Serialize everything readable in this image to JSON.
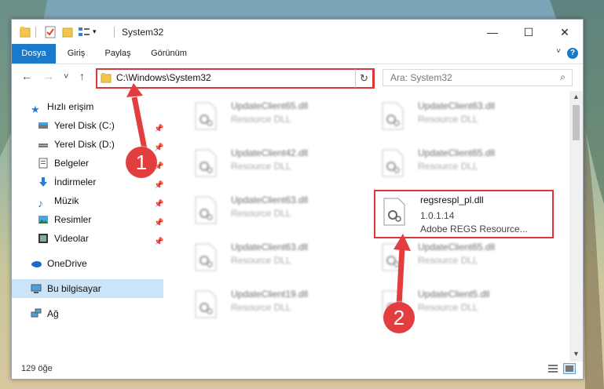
{
  "window": {
    "title": "System32",
    "controls": {
      "minimize": "—",
      "maximize": "☐",
      "close": "✕"
    }
  },
  "ribbon": {
    "tabs": [
      "Dosya",
      "Giriş",
      "Paylaş",
      "Görünüm"
    ],
    "help": "?"
  },
  "navigation": {
    "back": "←",
    "forward": "→",
    "recent": "˅",
    "up": "↑",
    "address": "C:\\Windows\\System32",
    "refresh": "↻",
    "dropdown": "˅",
    "search_placeholder": "Ara: System32"
  },
  "sidebar": {
    "items": [
      {
        "label": "Hızlı erişim",
        "icon": "star-icon"
      },
      {
        "label": "Yerel Disk (C:)",
        "icon": "drive-icon",
        "pinned": true
      },
      {
        "label": "Yerel Disk (D:)",
        "icon": "drive-icon",
        "pinned": true
      },
      {
        "label": "Belgeler",
        "icon": "document-icon",
        "pinned": true
      },
      {
        "label": "İndirmeler",
        "icon": "download-icon",
        "pinned": true
      },
      {
        "label": "Müzik",
        "icon": "music-icon",
        "pinned": true
      },
      {
        "label": "Resimler",
        "icon": "pictures-icon",
        "pinned": true
      },
      {
        "label": "Videolar",
        "icon": "video-icon",
        "pinned": true
      },
      {
        "label": "OneDrive",
        "icon": "cloud-icon"
      },
      {
        "label": "Bu bilgisayar",
        "icon": "computer-icon",
        "selected": true
      },
      {
        "label": "Ağ",
        "icon": "network-icon"
      }
    ]
  },
  "files": [
    {
      "name": "UpdateClient65.dll",
      "desc": "Resource DLL"
    },
    {
      "name": "UpdateClient63.dll",
      "desc": "Resource DLL"
    },
    {
      "name": "UpdateClient42.dll",
      "desc": "Resource DLL"
    },
    {
      "name": "UpdateClient65.dll",
      "desc": "Resource DLL"
    },
    {
      "name": "UpdateClient63.dll",
      "desc": "Resource DLL"
    },
    {
      "name": "regsrespl_pl.dll",
      "version": "1.0.1.14",
      "desc": "Adobe REGS Resource..."
    },
    {
      "name": "UpdateClient63.dll",
      "desc": "Resource DLL"
    },
    {
      "name": "UpdateClient65.dll",
      "desc": "Resource DLL"
    },
    {
      "name": "UpdateClient19.dll",
      "desc": "Resource DLL"
    },
    {
      "name": "UpdateClient5.dll",
      "desc": "Resource DLL"
    }
  ],
  "status": {
    "count": "129 öğe"
  },
  "annotations": {
    "step1": "1",
    "step2": "2",
    "color": "#e23d3f"
  }
}
